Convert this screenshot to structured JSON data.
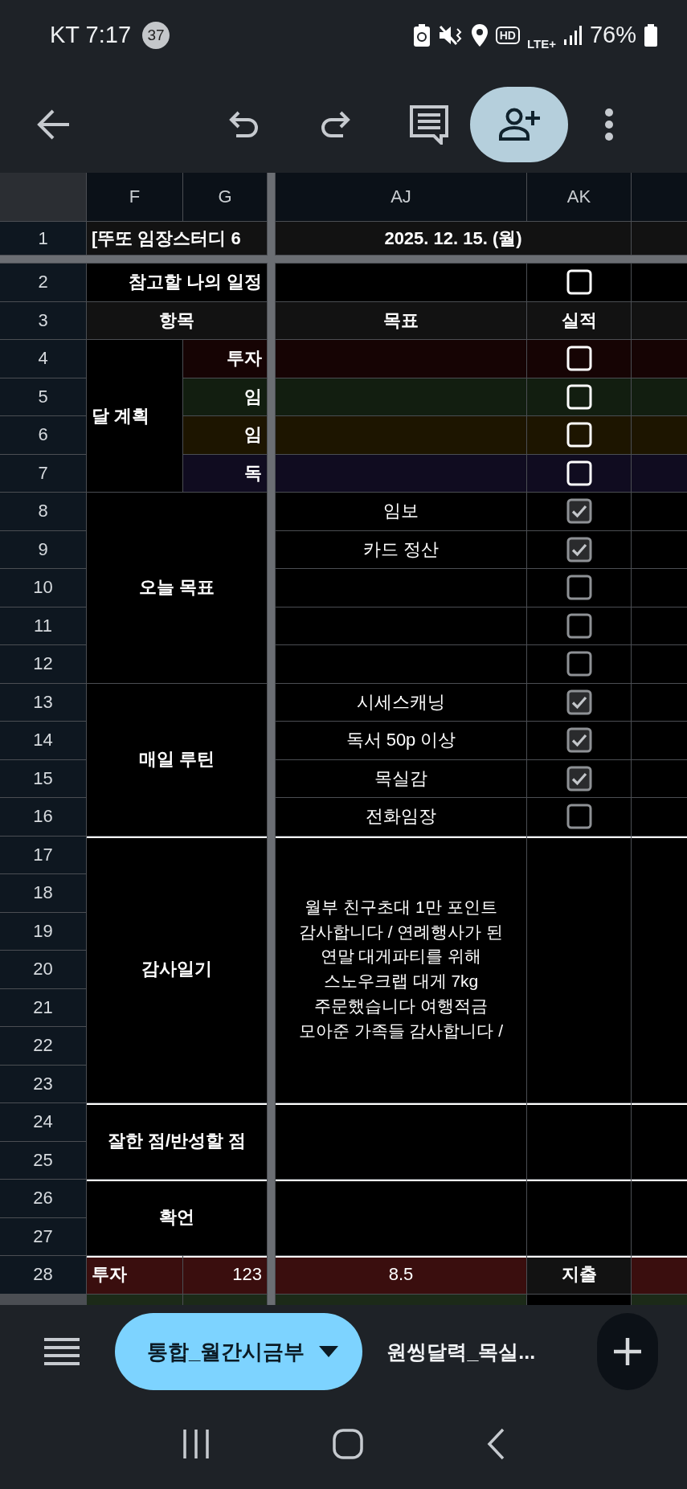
{
  "status_bar": {
    "carrier_time": "KT 7:17",
    "notification_count": "37",
    "hd": "HD",
    "network": "LTE+",
    "battery": "76%"
  },
  "sheet": {
    "columns": [
      {
        "label": "F"
      },
      {
        "label": "G"
      },
      {
        "label": "AJ"
      },
      {
        "label": "AK"
      }
    ],
    "row_numbers": [
      "1",
      "2",
      "3",
      "4",
      "5",
      "6",
      "7",
      "8",
      "9",
      "10",
      "11",
      "12",
      "13",
      "14",
      "15",
      "16",
      "17",
      "18",
      "19",
      "20",
      "21",
      "22",
      "23",
      "24",
      "25",
      "26",
      "27",
      "28"
    ],
    "title": "[뚜또 임장스터디 6",
    "date": "2025. 12. 15. (월)",
    "schedule": {
      "label": "참고할 나의 일정",
      "checked": false
    },
    "header": {
      "item": "항목",
      "goal": "목표",
      "result": "실적"
    },
    "monthly": {
      "label": "달 계획",
      "rows": [
        {
          "label": "투자",
          "color": "#160404",
          "checked": false
        },
        {
          "label": "임",
          "color": "#121e10",
          "checked": false
        },
        {
          "label": "임",
          "color": "#1d1500",
          "checked": false
        },
        {
          "label": "독",
          "color": "#100c20",
          "checked": false
        }
      ]
    },
    "sections": [
      {
        "label": "오늘 목표",
        "rows": [
          {
            "goal": "임보",
            "checked": true
          },
          {
            "goal": "카드 정산",
            "checked": true
          },
          {
            "checked": false
          },
          {
            "checked": false
          },
          {
            "checked": false
          }
        ]
      },
      {
        "label": "매일 루틴",
        "rows": [
          {
            "goal": "시세스캐닝",
            "checked": true
          },
          {
            "goal": "독서 50p 이상",
            "checked": true
          },
          {
            "goal": "목실감",
            "checked": true
          },
          {
            "goal": "전화임장",
            "checked": false
          }
        ]
      }
    ],
    "journal": [
      {
        "label": "감사일기",
        "text": "월부 친구초대 1만 포인트 감사합니다 / 연례행사가 된 연말 대게파티를 위해 스노우크랩 대게 7kg 주문했습니다 여행적금 모아준 가족들 감사합니다 /"
      },
      {
        "label": "잘한 점/반성할 점"
      },
      {
        "label": "확언"
      }
    ],
    "totals": [
      {
        "label": "투자",
        "value": "123",
        "goal_value": "8.5",
        "tag": "지출",
        "color": "#3a0e0e"
      },
      {
        "color": "#1c2a18"
      }
    ]
  },
  "sheet_tabs": [
    {
      "label": "통합_월간시금부",
      "selected": true
    },
    {
      "label": "원씽달력_목실...",
      "selected": false
    }
  ]
}
